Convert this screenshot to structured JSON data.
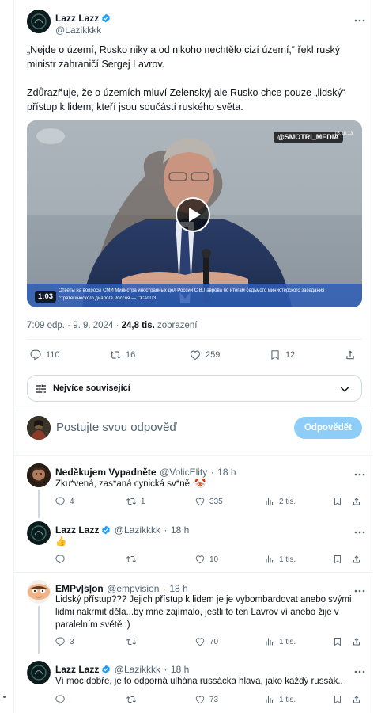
{
  "main_tweet": {
    "author_name": "Lazz Lazz",
    "handle": "@Lazikkkk",
    "paragraph1": "„Nejde o území, Rusko niky a od nikoho nechtělo cizí území,“ řekl ruský ministr zahraničí Sergej Lavrov.",
    "paragraph2": "Zdůrazňuje, že o územích mluví Zelenskyj ale Rusko chce pouze „lidský“ přístup k lidem, kteří jsou součástí ruského světa.",
    "video": {
      "watermark": "@SMOTRI_MEDIA",
      "timecode": "16:18:13",
      "duration": "1:03",
      "caption_line1": "Ответы на вопросы СМИ Министра иностранных дел России С.В.Лаврова по итогам седьмого министерского заседания",
      "caption_line2": "стратегического диалога Россия — ССАГПЗ"
    },
    "time": "7:09 odp.",
    "date": "9. 9. 2024",
    "views_count": "24,8 tis.",
    "views_label": "zobrazení",
    "stats": {
      "replies": "110",
      "reposts": "16",
      "likes": "259",
      "bookmarks": "12"
    }
  },
  "sort": {
    "label": "Nejvíce související"
  },
  "compose": {
    "placeholder": "Postujte svou odpověď",
    "button": "Odpovědět"
  },
  "replies": [
    {
      "author_name": "Neděkujem Vypadněte",
      "handle": "@VolicElity",
      "time": "18 h",
      "text": "Zku*vená, zas*aná cynická sv*ně. 🤡",
      "stats": {
        "replies": "4",
        "reposts": "1",
        "likes": "335",
        "views": "2 tis."
      }
    },
    {
      "author_name": "Lazz Lazz",
      "handle": "@Lazikkkk",
      "time": "18 h",
      "text": "👍",
      "stats": {
        "replies": "",
        "reposts": "",
        "likes": "10",
        "views": "1 tis."
      }
    },
    {
      "author_name": "EMPv|s|on",
      "handle": "@empvision",
      "time": "18 h",
      "text": "Lidský přístup??? Jejich přístup k lidem je je vybombardovat anebo svými lidmi nakrmit děla...by mne zajímalo, jestli to ten Lavrov ví anebo žije v paralelním světě :)",
      "stats": {
        "replies": "3",
        "reposts": "",
        "likes": "70",
        "views": "1 tis."
      }
    },
    {
      "author_name": "Lazz Lazz",
      "handle": "@Lazikkkk",
      "time": "18 h",
      "text": "Ví moc dobře, je to odporná ulhána russácka hlava, jako každý russák..",
      "stats": {
        "replies": "",
        "reposts": "",
        "likes": "73",
        "views": "1 tis."
      }
    }
  ],
  "colors": {
    "accent": "#1d9bf0",
    "button_disabled": "#8ecdf7",
    "text": "#0f1419",
    "muted": "#536471",
    "border": "#eff3f4"
  }
}
